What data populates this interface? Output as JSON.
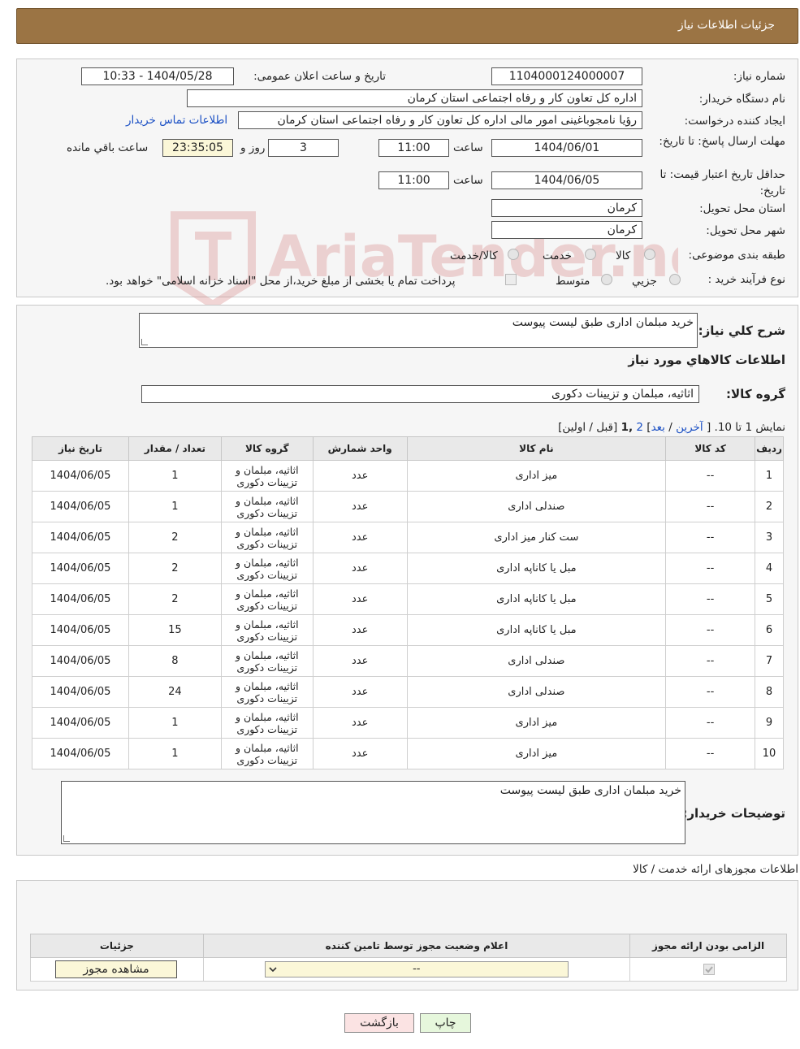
{
  "header": {
    "title": "جزئیات اطلاعات نیاز"
  },
  "form": {
    "need_number_label": "شماره نیاز:",
    "need_number": "1104000124000007",
    "announce_label": "تاریخ و ساعت اعلان عمومی:",
    "announce_value": "1404/05/28 - 10:33",
    "buyer_label": "نام دستگاه خریدار:",
    "buyer_value": "اداره کل تعاون  کار و رفاه اجتماعی استان کرمان",
    "requester_label": "ایجاد کننده درخواست:",
    "requester_value": "رؤیا نامجوباغینی امور مالی اداره کل تعاون  کار و رفاه اجتماعی استان کرمان",
    "contact_link": "اطلاعات تماس خریدار",
    "deadline_label": "مهلت ارسال پاسخ: تا تاریخ:",
    "deadline_date": "1404/06/01",
    "time_label": "ساعت",
    "deadline_time": "11:00",
    "days_value": "3",
    "days_label": "روز و",
    "remaining_value": "23:35:05",
    "remaining_label": "ساعت باقي مانده",
    "validity_label": "حداقل تاریخ اعتبار قیمت: تا تاریخ:",
    "validity_date": "1404/06/05",
    "validity_time": "11:00",
    "province_label": "استان محل تحویل:",
    "province_value": "کرمان",
    "city_label": "شهر محل تحویل:",
    "city_value": "کرمان",
    "category_label": "طبقه بندی موضوعی:",
    "category_options": [
      "کالا",
      "خدمت",
      "کالا/خدمت"
    ],
    "process_label": "نوع فرآیند خرید :",
    "process_options": [
      "جزیي",
      "متوسط"
    ],
    "payment_note": "پرداخت تمام یا بخشی از مبلغ خرید،از محل \"اسناد خزانه اسلامی\" خواهد بود."
  },
  "watermark": {
    "text": "AriaTender.neT"
  },
  "summary": {
    "label": "شرح کلي نياز:",
    "value": "خرید مبلمان اداری طبق لیست پیوست",
    "goods_info_title": "اطلاعات کالاهاي مورد نياز",
    "group_label": "گروه کالا:",
    "group_value": "اثاثیه، مبلمان و تزیینات دکوری",
    "pager_prefix": "نمایش 1 تا 10. [",
    "pager_last": "آخرین",
    "pager_sep": "/",
    "pager_next": "بعد",
    "pager_page2": "2",
    "pager_page1": ",1",
    "pager_suffix": "[قبل / اولین]"
  },
  "table": {
    "headers": [
      "رديف",
      "کد کالا",
      "نام کالا",
      "واحد شمارش",
      "گروه کالا",
      "تعداد / مقدار",
      "تاریخ نیاز"
    ],
    "rows": [
      [
        "1",
        "--",
        "میز اداری",
        "عدد",
        "اثاثیه، مبلمان و تزیینات دکوری",
        "1",
        "1404/06/05"
      ],
      [
        "2",
        "--",
        "صندلی اداری",
        "عدد",
        "اثاثیه، مبلمان و تزیینات دکوری",
        "1",
        "1404/06/05"
      ],
      [
        "3",
        "--",
        "ست کنار میز اداری",
        "عدد",
        "اثاثیه، مبلمان و تزیینات دکوری",
        "2",
        "1404/06/05"
      ],
      [
        "4",
        "--",
        "مبل یا کاناپه اداری",
        "عدد",
        "اثاثیه، مبلمان و تزیینات دکوری",
        "2",
        "1404/06/05"
      ],
      [
        "5",
        "--",
        "مبل یا کاناپه اداری",
        "عدد",
        "اثاثیه، مبلمان و تزیینات دکوری",
        "2",
        "1404/06/05"
      ],
      [
        "6",
        "--",
        "مبل یا کاناپه اداری",
        "عدد",
        "اثاثیه، مبلمان و تزیینات دکوری",
        "15",
        "1404/06/05"
      ],
      [
        "7",
        "--",
        "صندلی اداری",
        "عدد",
        "اثاثیه، مبلمان و تزیینات دکوری",
        "8",
        "1404/06/05"
      ],
      [
        "8",
        "--",
        "صندلی اداری",
        "عدد",
        "اثاثیه، مبلمان و تزیینات دکوری",
        "24",
        "1404/06/05"
      ],
      [
        "9",
        "--",
        "میز اداری",
        "عدد",
        "اثاثیه، مبلمان و تزیینات دکوری",
        "1",
        "1404/06/05"
      ],
      [
        "10",
        "--",
        "میز اداری",
        "عدد",
        "اثاثیه، مبلمان و تزیینات دکوری",
        "1",
        "1404/06/05"
      ]
    ]
  },
  "buyer_notes": {
    "label": "توضیحات خریدار:",
    "value": "خرید مبلمان اداری طبق لیست پیوست"
  },
  "license": {
    "title": "اطلاعات مجوزهای ارائه خدمت / کالا",
    "headers": [
      "الزامی بودن ارائه مجوز",
      "اعلام وضعیت مجوز توسط تامین کننده",
      "جزئیات"
    ],
    "select_value": "--",
    "view_button": "مشاهده مجوز"
  },
  "buttons": {
    "print": "چاپ",
    "back": "بازگشت"
  },
  "colors": {
    "header_bg": "#9b7444",
    "print_bg": "#e6f7dc",
    "back_bg": "#fbe3e3"
  }
}
